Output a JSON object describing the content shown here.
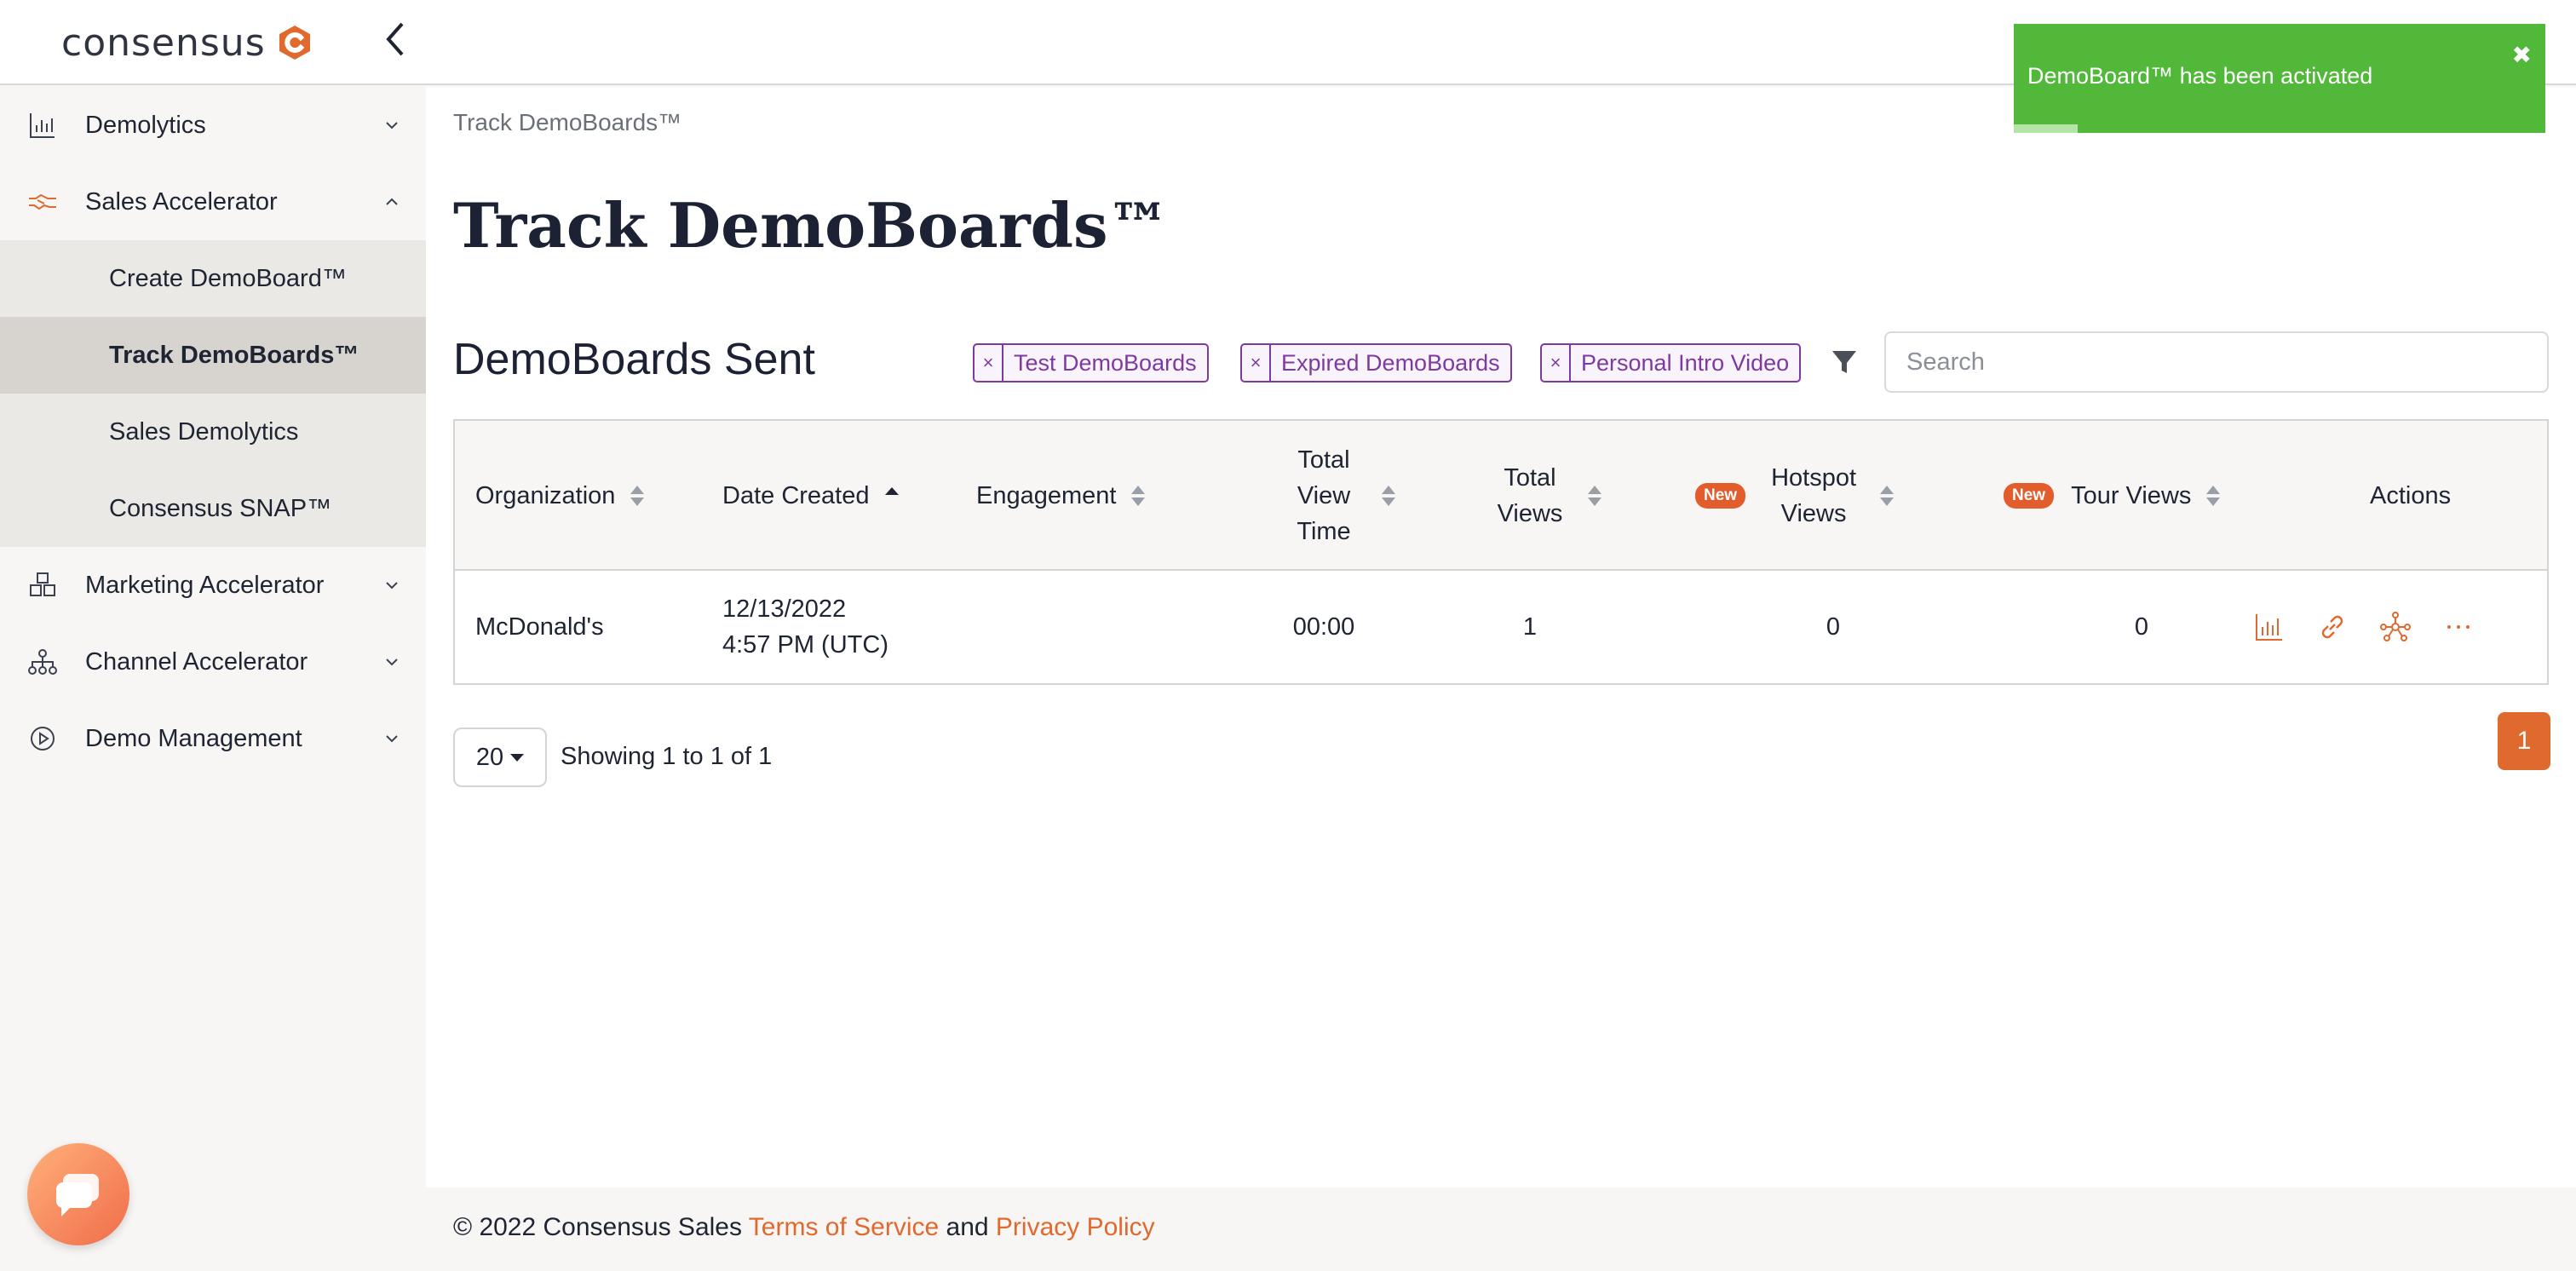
{
  "brand": {
    "name": "consensus",
    "accent_color": "#e0692e"
  },
  "sidebar": {
    "items": [
      {
        "label": "Demolytics",
        "icon": "bar-chart-icon"
      },
      {
        "label": "Sales Accelerator",
        "icon": "handshake-icon"
      },
      {
        "label": "Marketing Accelerator",
        "icon": "cubes-icon"
      },
      {
        "label": "Channel Accelerator",
        "icon": "network-icon"
      },
      {
        "label": "Demo Management",
        "icon": "play-circle-icon"
      }
    ],
    "sub_items": [
      {
        "label": "Create DemoBoard™"
      },
      {
        "label": "Track DemoBoards™"
      },
      {
        "label": "Sales Demolytics"
      },
      {
        "label": "Consensus SNAP™"
      }
    ]
  },
  "breadcrumb": "Track DemoBoards™",
  "page_title": "Track DemoBoards™",
  "section_title": "DemoBoards Sent",
  "filter_chips": [
    {
      "label": "Test DemoBoards",
      "remove": "×"
    },
    {
      "label": "Expired DemoBoards",
      "remove": "×"
    },
    {
      "label": "Personal Intro Video",
      "remove": "×"
    }
  ],
  "search": {
    "placeholder": "Search",
    "value": ""
  },
  "table": {
    "columns": [
      {
        "label": "Organization"
      },
      {
        "label": "Date Created"
      },
      {
        "label": "Engagement"
      },
      {
        "label": "Total View Time"
      },
      {
        "label": "Total Views"
      },
      {
        "label": "Hotspot Views",
        "badge": "New"
      },
      {
        "label": "Tour Views",
        "badge": "New"
      },
      {
        "label": "Actions"
      }
    ],
    "rows": [
      {
        "organization": "McDonald's",
        "date_line1": "12/13/2022",
        "date_line2": "4:57 PM (UTC)",
        "engagement": "",
        "total_view_time": "00:00",
        "total_views": "1",
        "hotspot_views": "0",
        "tour_views": "0"
      }
    ],
    "row_actions": [
      "analytics-icon",
      "link-icon",
      "share-network-icon",
      "more-icon"
    ]
  },
  "pagination": {
    "page_size": "20",
    "showing": "Showing 1 to 1 of 1",
    "current_page": "1"
  },
  "footer": {
    "copyright": "© 2022 Consensus Sales",
    "terms": "Terms of Service",
    "and": "and",
    "privacy": "Privacy Policy"
  },
  "toast": {
    "message": "DemoBoard™ has been activated",
    "close": "✖",
    "progress": 0.12,
    "color": "#51b83a"
  }
}
